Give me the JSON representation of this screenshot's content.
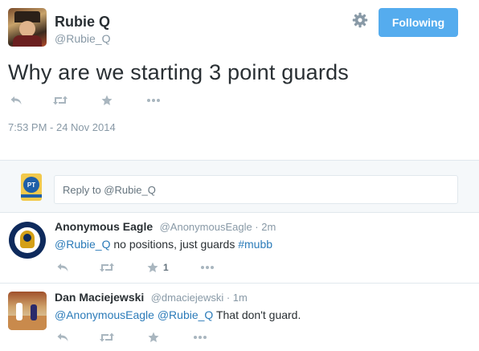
{
  "tweet": {
    "user_name": "Rubie Q",
    "user_handle": "@Rubie_Q",
    "follow_label": "Following",
    "text": "Why are we starting 3 point guards",
    "timestamp": "7:53 PM - 24 Nov 2014"
  },
  "reply_box": {
    "avatar_text": "PT",
    "placeholder": "Reply to @Rubie_Q"
  },
  "replies": [
    {
      "name": "Anonymous Eagle",
      "handle": "@AnonymousEagle · 2m",
      "mention": "@Rubie_Q",
      "text": " no positions, just guards ",
      "hashtag": "#mubb",
      "favorite_count": "1"
    },
    {
      "name": "Dan Maciejewski",
      "handle": "@dmaciejewski · 1m",
      "mention1": "@AnonymousEagle",
      "mention2": "@Rubie_Q",
      "text": " That don't guard."
    }
  ],
  "colors": {
    "accent": "#55acee",
    "link": "#2b7bb9",
    "muted": "#8899a6",
    "icon": "#a9b6bf"
  },
  "icons": [
    "reply-icon",
    "retweet-icon",
    "favorite-icon",
    "more-icon",
    "gear-icon"
  ]
}
